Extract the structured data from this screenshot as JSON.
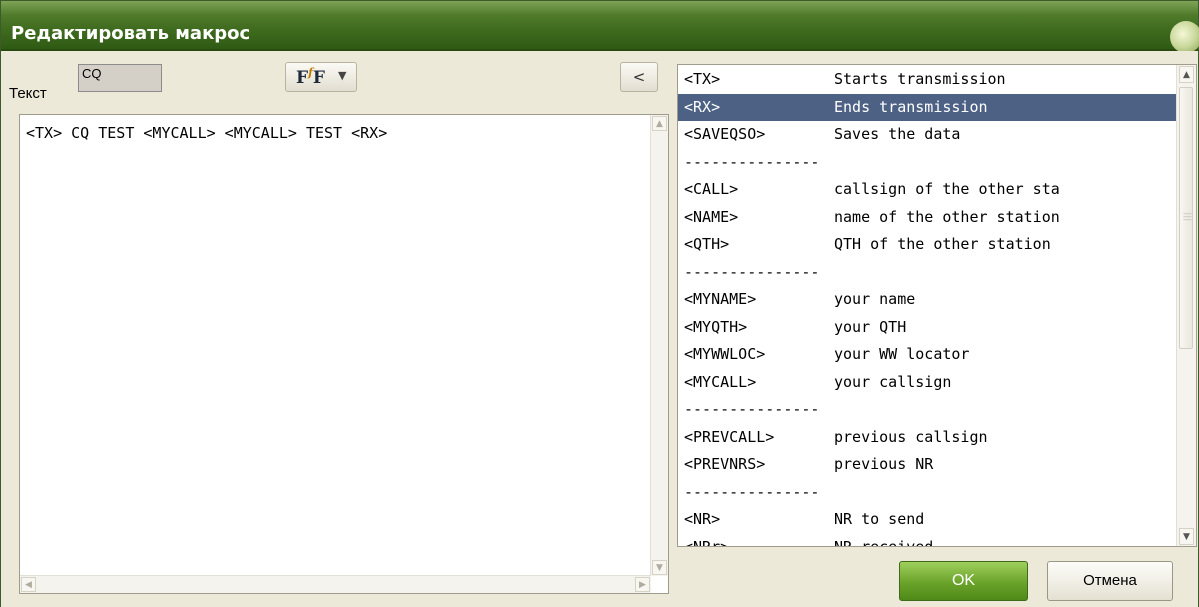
{
  "window": {
    "title": "Редактировать макрос"
  },
  "form": {
    "text_label": "Текст",
    "text_value": "CQ"
  },
  "toolbar": {
    "font_icon": "font-style-icon",
    "collapse_label": "<"
  },
  "editor": {
    "content": "<TX> CQ TEST <MYCALL> <MYCALL> TEST <RX>"
  },
  "macro_list": {
    "items": [
      {
        "tag": "<TX>",
        "desc": "Starts transmission",
        "selected": false
      },
      {
        "tag": "<RX>",
        "desc": "Ends transmission",
        "selected": true
      },
      {
        "tag": "<SAVEQSO>",
        "desc": "Saves the data",
        "selected": false
      },
      {
        "tag": "---------------",
        "desc": "",
        "selected": false
      },
      {
        "tag": "<CALL>",
        "desc": "callsign of the other sta",
        "selected": false
      },
      {
        "tag": "<NAME>",
        "desc": "name of the other station",
        "selected": false
      },
      {
        "tag": "<QTH>",
        "desc": "QTH of the other station",
        "selected": false
      },
      {
        "tag": "---------------",
        "desc": "",
        "selected": false
      },
      {
        "tag": "<MYNAME>",
        "desc": "your name",
        "selected": false
      },
      {
        "tag": "<MYQTH>",
        "desc": "your QTH",
        "selected": false
      },
      {
        "tag": "<MYWWLOC>",
        "desc": "your WW locator",
        "selected": false
      },
      {
        "tag": "<MYCALL>",
        "desc": "your callsign",
        "selected": false
      },
      {
        "tag": "---------------",
        "desc": "",
        "selected": false
      },
      {
        "tag": "<PREVCALL>",
        "desc": "previous callsign",
        "selected": false
      },
      {
        "tag": "<PREVNRS>",
        "desc": "previous NR",
        "selected": false
      },
      {
        "tag": "---------------",
        "desc": "",
        "selected": false
      },
      {
        "tag": "<NR>",
        "desc": "NR to send",
        "selected": false
      },
      {
        "tag": "<NRr>",
        "desc": "NR received",
        "selected": false
      }
    ]
  },
  "buttons": {
    "ok_label": "OK",
    "cancel_label": "Отмена"
  },
  "colors": {
    "title_bar": "#3f6b1f",
    "selection": "#4d6185",
    "ok_button": "#6aa32a"
  }
}
